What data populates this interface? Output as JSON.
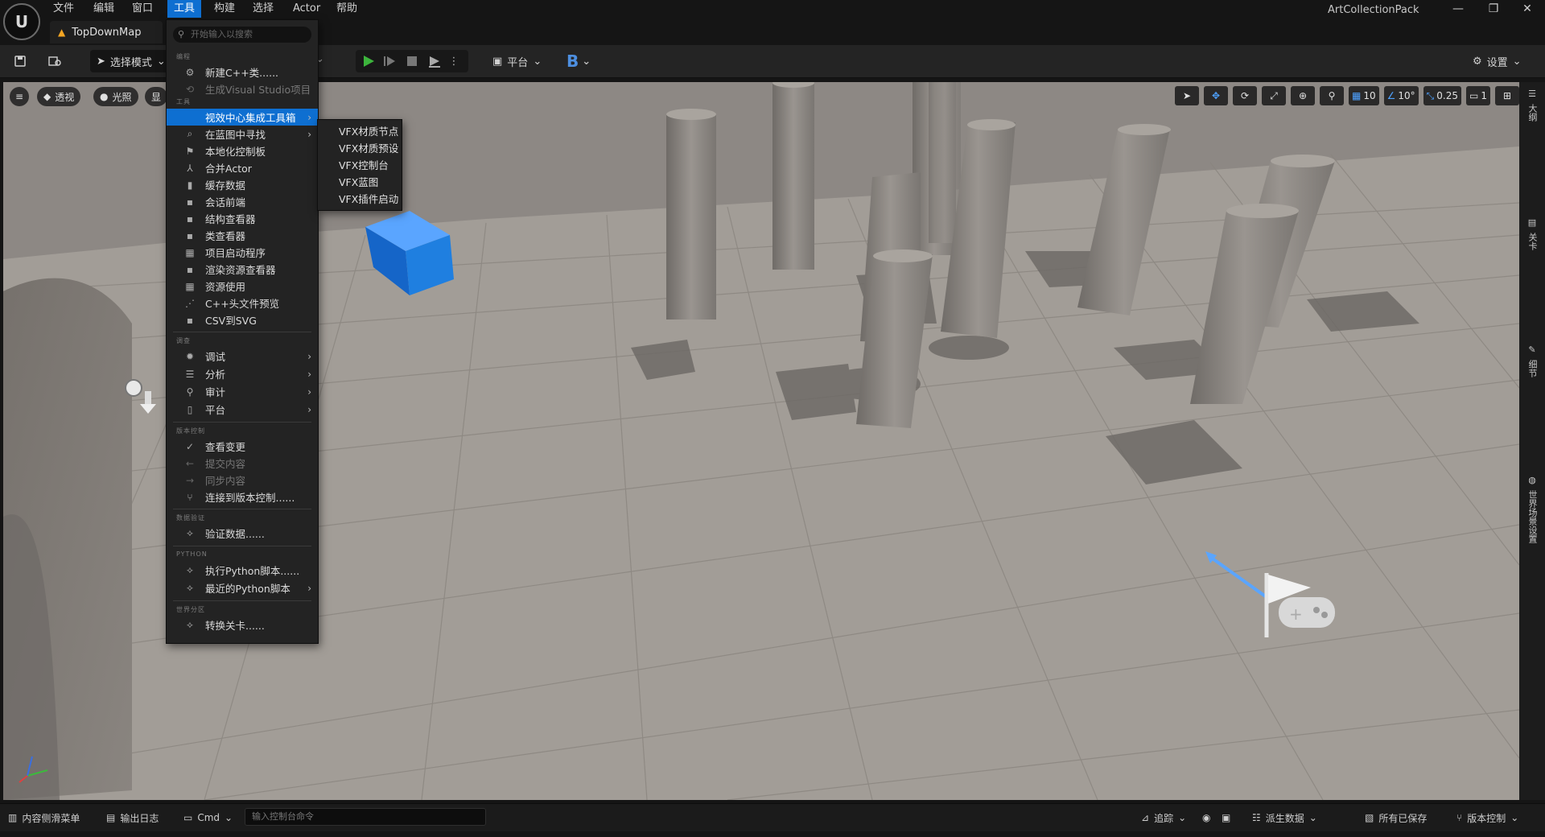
{
  "app_title": "ArtCollectionPack",
  "menubar": [
    "文件",
    "编辑",
    "窗口",
    "工具",
    "构建",
    "选择",
    "Actor",
    "帮助"
  ],
  "active_menu": "工具",
  "window_controls": [
    "—",
    "❐",
    "✕"
  ],
  "doc_tab": "TopDownMap",
  "toolbar": {
    "select_mode": "选择模式",
    "platform": "平台",
    "b_label": "B",
    "settings": "设置"
  },
  "viewport": {
    "perspective": "透视",
    "lighting": "光照",
    "show": "显",
    "grid_snap": "10",
    "rotate_snap": "10°",
    "scale_snap": "0.25",
    "camera_speed": "1"
  },
  "side_tabs": [
    "大纲",
    "关卡",
    "细节",
    "世界场景设置"
  ],
  "dropdown": {
    "search_placeholder": "开始输入以搜索",
    "sections": {
      "programming": "编程",
      "tools": "工具",
      "profiling": "调查",
      "source_control": "版本控制",
      "data_validation": "数据验证",
      "python": "PYTHON",
      "world_partition": "世界分区"
    },
    "programming_items": [
      {
        "label": "新建C++类......",
        "icon": "class-icon",
        "disabled": false
      },
      {
        "label": "生成Visual Studio项目",
        "icon": "refresh-icon",
        "disabled": true
      }
    ],
    "tools_items": [
      {
        "label": "视效中心集成工具箱",
        "icon": "",
        "submenu": true,
        "active": true
      },
      {
        "label": "在蓝图中寻找",
        "icon": "search-icon",
        "submenu": true
      },
      {
        "label": "本地化控制板",
        "icon": "flag-icon"
      },
      {
        "label": "合并Actor",
        "icon": "merge-icon"
      },
      {
        "label": "缓存数据",
        "icon": "chart-icon"
      },
      {
        "label": "会话前端",
        "icon": "session-icon"
      },
      {
        "label": "结构查看器",
        "icon": "structure-icon"
      },
      {
        "label": "类查看器",
        "icon": "class-viewer-icon"
      },
      {
        "label": "项目启动程序",
        "icon": "launcher-icon"
      },
      {
        "label": "渲染资源查看器",
        "icon": "render-icon"
      },
      {
        "label": "资源使用",
        "icon": "grid-icon"
      },
      {
        "label": "C++头文件预览",
        "icon": "header-icon"
      },
      {
        "label": "CSV到SVG",
        "icon": "csv-icon"
      }
    ],
    "profiling_items": [
      {
        "label": "调试",
        "icon": "bug-icon",
        "submenu": true
      },
      {
        "label": "分析",
        "icon": "analysis-icon",
        "submenu": true
      },
      {
        "label": "审计",
        "icon": "audit-icon",
        "submenu": true
      },
      {
        "label": "平台",
        "icon": "platform-icon",
        "submenu": true
      }
    ],
    "source_control_items": [
      {
        "label": "查看变更",
        "icon": "check-icon",
        "disabled": false
      },
      {
        "label": "提交内容",
        "icon": "arrow-left-icon",
        "disabled": true
      },
      {
        "label": "同步内容",
        "icon": "arrow-right-icon",
        "disabled": true
      },
      {
        "label": "连接到版本控制......",
        "icon": "branch-icon",
        "disabled": false
      }
    ],
    "data_validation_items": [
      {
        "label": "验证数据......",
        "icon": "validate-icon"
      }
    ],
    "python_items": [
      {
        "label": "执行Python脚本......",
        "icon": "python-icon"
      },
      {
        "label": "最近的Python脚本",
        "icon": "python-recent-icon",
        "submenu": true
      }
    ],
    "world_partition_items": [
      {
        "label": "转换关卡......",
        "icon": "convert-icon"
      }
    ]
  },
  "submenu": [
    "VFX材质节点",
    "VFX材质预设",
    "VFX控制台",
    "VFX蓝图",
    "VFX插件启动"
  ],
  "bottombar": {
    "content_drawer": "内容侧滑菜单",
    "output_log": "输出日志",
    "cmd": "Cmd",
    "cmd_placeholder": "输入控制台命令",
    "trace": "追踪",
    "derived_data": "派生数据",
    "all_saved": "所有已保存",
    "source_control": "版本控制"
  },
  "colors": {
    "accent": "#0e6fd1",
    "play_green": "#3cb43c",
    "cube_blue": "#1f7fe0",
    "floor": "#9b9590"
  }
}
